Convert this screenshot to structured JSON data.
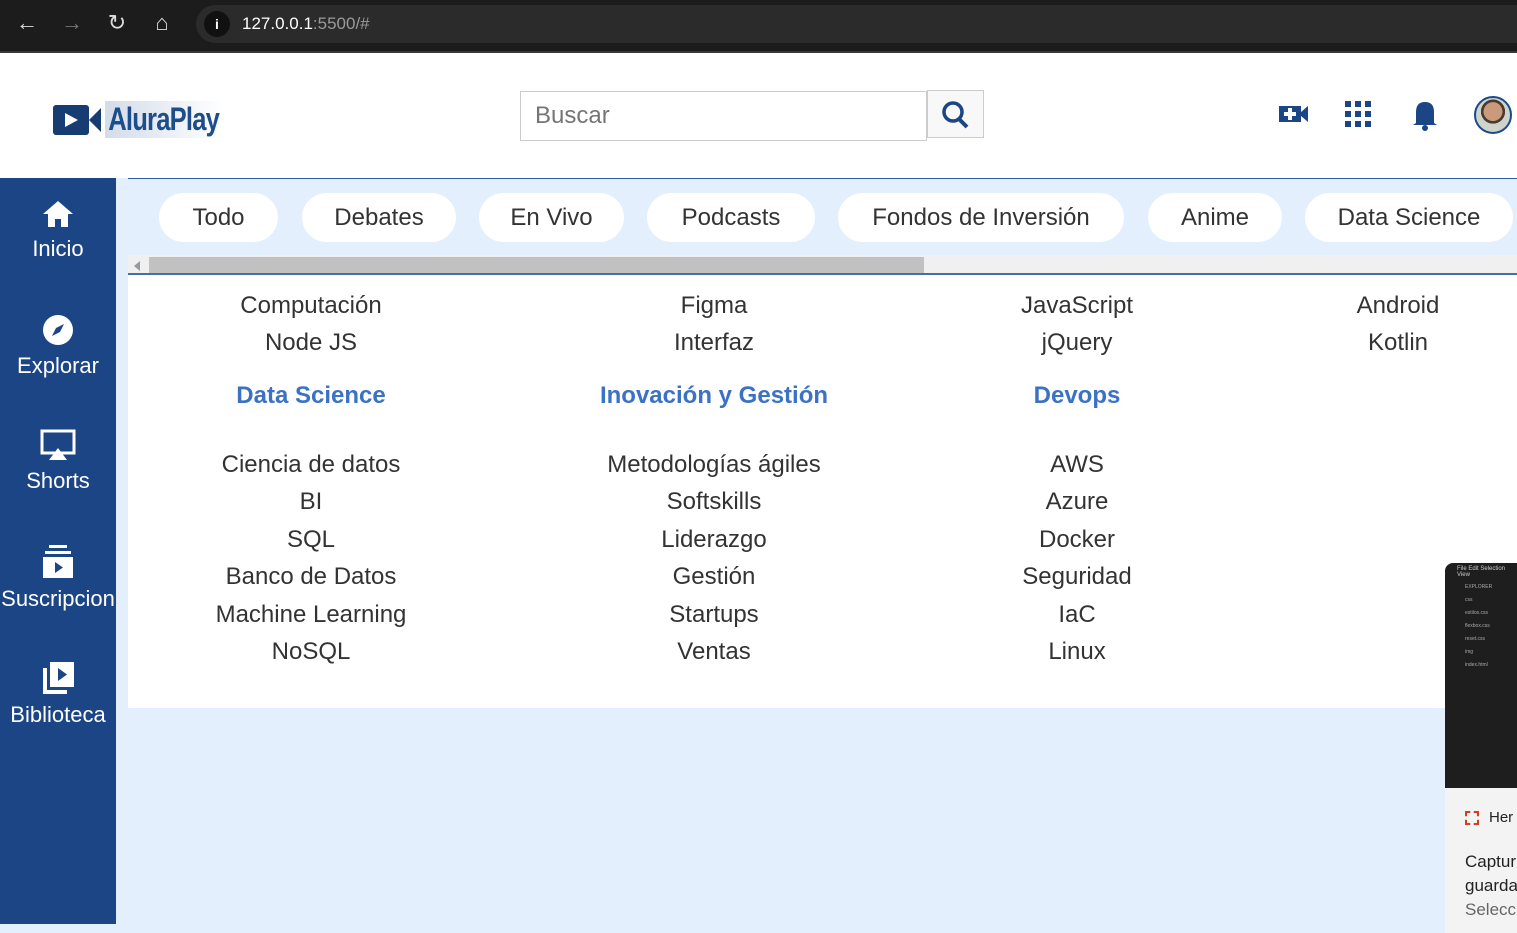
{
  "browser": {
    "url_host": "127.0.0.1",
    "url_rest": ":5500/#"
  },
  "header": {
    "logo_text": "AluraPlay",
    "search_placeholder": "Buscar",
    "brand_color": "#1b4585"
  },
  "sidebar": {
    "items": [
      {
        "label": "Inicio",
        "icon": "home-icon"
      },
      {
        "label": "Explorar",
        "icon": "compass-icon"
      },
      {
        "label": "Shorts",
        "icon": "airplay-icon"
      },
      {
        "label": "Suscripcion",
        "icon": "subscriptions-icon"
      },
      {
        "label": "Biblioteca",
        "icon": "library-icon"
      }
    ]
  },
  "categories": [
    "Todo",
    "Debates",
    "En Vivo",
    "Podcasts",
    "Fondos de Inversión",
    "Anime",
    "Data Science"
  ],
  "menu": {
    "top_rows": [
      [
        "Computación",
        "Node JS"
      ],
      [
        "Figma",
        "Interfaz"
      ],
      [
        "JavaScript",
        "jQuery"
      ],
      [
        "Android",
        "Kotlin"
      ]
    ],
    "sections": [
      {
        "title": "Data Science",
        "items": [
          "Ciencia de datos",
          "BI",
          "SQL",
          "Banco de Datos",
          "Machine Learning",
          "NoSQL"
        ]
      },
      {
        "title": "Inovación y Gestión",
        "items": [
          "Metodologías ágiles",
          "Softskills",
          "Liderazgo",
          "Gestión",
          "Startups",
          "Ventas"
        ]
      },
      {
        "title": "Devops",
        "items": [
          "AWS",
          "Azure",
          "Docker",
          "Seguridad",
          "IaC",
          "Linux"
        ]
      }
    ],
    "heading_color": "#3b72c4"
  },
  "popup": {
    "menu": "File  Edit  Selection  View",
    "explorer": "EXPLORER",
    "files": [
      "css",
      "estilos.css",
      "flexbox.css",
      "reset.css",
      "img",
      "index.html"
    ],
    "title": "Her",
    "body1": "Captur",
    "body2": "guarda",
    "body3": "Selecci"
  }
}
